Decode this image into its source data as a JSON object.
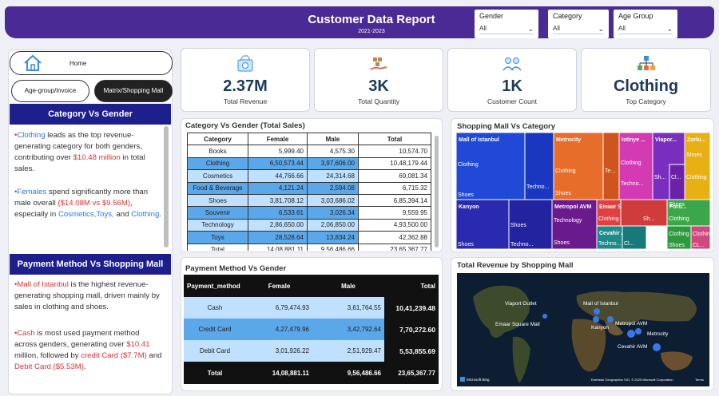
{
  "header": {
    "title": "Customer Data Report",
    "subtitle": "2021-2023"
  },
  "slicers": [
    {
      "label": "Gender",
      "value": "All"
    },
    {
      "label": "Category",
      "value": "All"
    },
    {
      "label": "Age Group",
      "value": "All"
    }
  ],
  "nav": {
    "home": "Home",
    "age_group": "Age-group/invoice",
    "matrix": "Matrix/Shopping Mall"
  },
  "section1": {
    "title": "Category Vs Gender",
    "b1": [
      {
        "t": "Clothing",
        "c": "hl"
      },
      {
        "t": " leads as the top revenue-generating category for both genders, contributing over ",
        "c": ""
      },
      {
        "t": "$10.48 million",
        "c": "red"
      },
      {
        "t": " in total sales.",
        "c": ""
      }
    ],
    "b2": [
      {
        "t": "Females",
        "c": "hl"
      },
      {
        "t": " spend significantly more than male overall ",
        "c": ""
      },
      {
        "t": "($14.08M vs $9.56M)",
        "c": "red"
      },
      {
        "t": ", especially in ",
        "c": ""
      },
      {
        "t": "Cosmetics,Toys,",
        "c": "hl"
      },
      {
        "t": " and ",
        "c": ""
      },
      {
        "t": "Clothing",
        "c": "hl"
      },
      {
        "t": ".",
        "c": ""
      }
    ]
  },
  "section2": {
    "title": "Payment Method Vs Shopping Mall",
    "b1": [
      {
        "t": "Mall of Istanbul",
        "c": "red"
      },
      {
        "t": " is the highest revenue-generating shopping mall, driven mainly by sales in clothing and shoes.",
        "c": ""
      }
    ],
    "b2": [
      {
        "t": "Cash",
        "c": "red"
      },
      {
        "t": " is most used payment method across genders, generating over ",
        "c": ""
      },
      {
        "t": "$10.41",
        "c": "red"
      },
      {
        "t": " million, followed by ",
        "c": ""
      },
      {
        "t": "credit Card ($7.7M)",
        "c": "red"
      },
      {
        "t": " and ",
        "c": ""
      },
      {
        "t": "Debit Card ($5.53M)",
        "c": "red"
      },
      {
        "t": ".",
        "c": ""
      }
    ]
  },
  "kpis": [
    {
      "value": "2.37M",
      "label": "Total Revenue",
      "icon": "money-icon"
    },
    {
      "value": "3K",
      "label": "Total Quantity",
      "icon": "quantity-icon"
    },
    {
      "value": "1K",
      "label": "Customer Count",
      "icon": "customers-icon"
    },
    {
      "value": "Clothing",
      "label": "Top Category",
      "icon": "category-icon"
    }
  ],
  "table1": {
    "title": "Category Vs Gender (Total Sales)",
    "headers": [
      "Category",
      "Female",
      "Male",
      "Total"
    ],
    "rows": [
      [
        "Books",
        "5,999.40",
        "4,575.30",
        "10,574.70"
      ],
      [
        "Clothing",
        "6,50,573.44",
        "3,97,606.00",
        "10,48,179.44"
      ],
      [
        "Cosmetics",
        "44,766.66",
        "24,314.68",
        "69,081.34"
      ],
      [
        "Food & Beverage",
        "4,121.24",
        "2,594.08",
        "6,715.32"
      ],
      [
        "Shoes",
        "3,81,708.12",
        "3,03,686.02",
        "6,85,394.14"
      ],
      [
        "Souvenir",
        "6,533.61",
        "3,026.34",
        "9,559.95"
      ],
      [
        "Technology",
        "2,86,650.00",
        "2,06,850.00",
        "4,93,500.00"
      ],
      [
        "Toys",
        "28,528.64",
        "13,834.24",
        "42,362.88"
      ],
      [
        "Total",
        "14,08,881.11",
        "9,56,486.66",
        "23,65,367.77"
      ]
    ]
  },
  "table2": {
    "title": "Payment Method Vs Gender",
    "headers": [
      "Payment_method",
      "Female",
      "Male",
      "Total"
    ],
    "rows": [
      [
        "Cash",
        "6,79,474.93",
        "3,61,764.55",
        "10,41,239.48"
      ],
      [
        "Credit Card",
        "4,27,479.96",
        "3,42,792.64",
        "7,70,272.60"
      ],
      [
        "Debit Card",
        "3,01,926.22",
        "2,51,929.47",
        "5,53,855.69"
      ],
      [
        "Total",
        "14,08,881.11",
        "9,56,486.66",
        "23,65,367.77"
      ]
    ]
  },
  "treemap": {
    "title": "Shopping Mall Vs Category",
    "malls": [
      "Mall of Istanbul",
      "Metrocity",
      "Istinye ...",
      "Viapor...",
      "Zorlu...",
      "Kanyon",
      "Metropol AVM",
      "Emaar Square Mall",
      "Foru...",
      "Cevahir AVM"
    ],
    "cells": [
      "Clothing",
      "Techno...",
      "Shoes",
      "Clothing",
      "Te...",
      "Shoes",
      "Clothing",
      "Techno...",
      "Sh...",
      "Cl...",
      "Shoes",
      "Clothing",
      "Techno...",
      "Shoes",
      "Shoes",
      "Techno...",
      "Technology",
      "Shoes",
      "Clothing",
      "Sh...",
      "Techno...",
      "Cl...",
      "Clothing",
      "Shoes",
      "Clothing",
      "Shoes",
      "Clothing",
      "CL..."
    ]
  },
  "map": {
    "title": "Total Revenue by Shopping Mall",
    "labels": [
      "Viaport Outlet",
      "Mall of Istanbul",
      "Emaar Square Mall",
      "Kanyon",
      "Metropol AVM",
      "Metrocity",
      "Cevahir AVM"
    ],
    "attribution": "Microsoft Bing",
    "copyright": "Earthstar Geographics SIO, © 2025 Microsoft Corporation",
    "terms": "Terms"
  },
  "colors": {
    "header": "#4a2a94",
    "nav_dark": "#1c1f8c",
    "tbl_light": "#bfe0ff",
    "tbl_mid": "#5aa7ea",
    "tbl_total": "#111111"
  }
}
